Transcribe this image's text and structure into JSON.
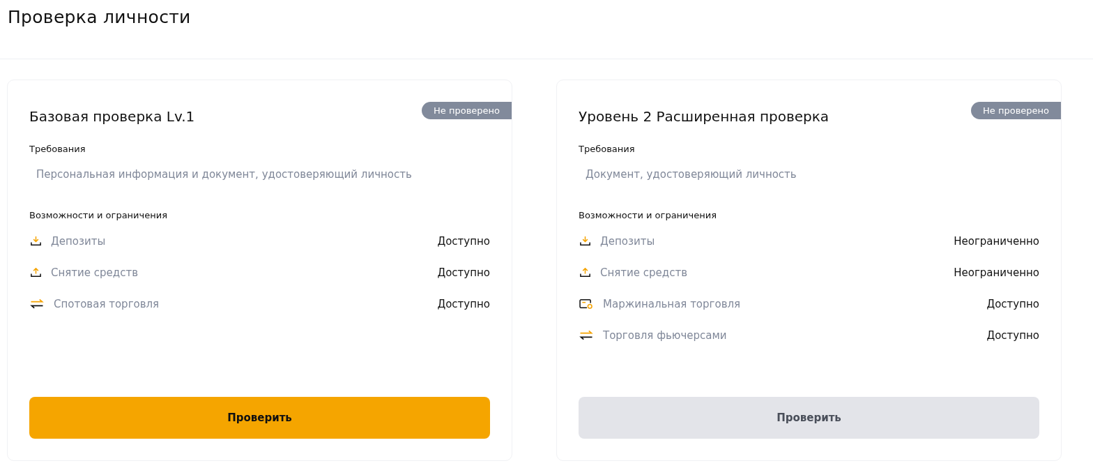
{
  "page": {
    "title": "Проверка личности"
  },
  "cards": [
    {
      "title": "Базовая проверка Lv.1",
      "status": "Не проверено",
      "requirements_label": "Требования",
      "requirements": "Персональная информация и документ, удостоверяющий личность",
      "features_label": "Возможности и ограничения",
      "features": [
        {
          "kind": "deposit",
          "label": "Депозиты",
          "value": "Доступно"
        },
        {
          "kind": "withdraw",
          "label": "Снятие средств",
          "value": "Доступно"
        },
        {
          "kind": "trade",
          "label": "Спотовая торговля",
          "value": "Доступно"
        }
      ],
      "button": {
        "label": "Проверить",
        "disabled": false
      }
    },
    {
      "title": "Уровень 2 Расширенная проверка",
      "status": "Не проверено",
      "requirements_label": "Требования",
      "requirements": "Документ, удостоверяющий личность",
      "features_label": "Возможности и ограничения",
      "features": [
        {
          "kind": "deposit",
          "label": "Депозиты",
          "value": "Неограниченно"
        },
        {
          "kind": "withdraw",
          "label": "Снятие средств",
          "value": "Неограниченно"
        },
        {
          "kind": "margin",
          "label": "Маржинальная торговля",
          "value": "Доступно"
        },
        {
          "kind": "trade",
          "label": "Торговля фьючерсами",
          "value": "Доступно"
        }
      ],
      "button": {
        "label": "Проверить",
        "disabled": true
      }
    }
  ]
}
